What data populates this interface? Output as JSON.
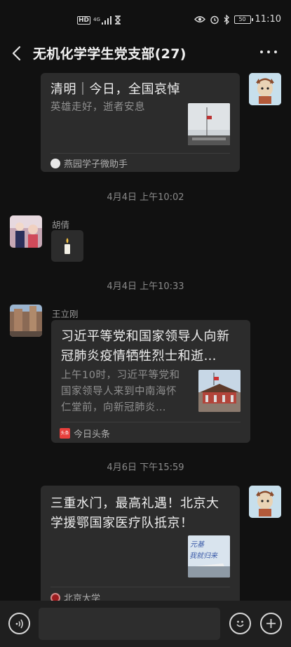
{
  "status_bar": {
    "hd": "HD",
    "network": "4G",
    "battery": "50",
    "time": "11:10"
  },
  "header": {
    "title": "无机化学学生党支部(27)"
  },
  "messages": [
    {
      "type": "card",
      "title": "清明｜今日，全国哀悼",
      "desc": "英雄走好，逝者安息",
      "source": "燕园学子微助手"
    },
    {
      "type": "time",
      "text": "4月4日 上午10:02"
    },
    {
      "type": "text",
      "sender": "胡倩",
      "content": "🕯"
    },
    {
      "type": "time",
      "text": "4月4日 上午10:33"
    },
    {
      "type": "card",
      "sender": "王立刚",
      "title_lines": [
        "习近平等党和国家领导人向新",
        "冠肺炎疫情牺牲烈士和逝…"
      ],
      "desc_lines": [
        "上午10时，习近平等党和",
        "国家领导人来到中南海怀",
        "仁堂前，向新冠肺炎…"
      ],
      "source": "今日头条",
      "source_icon_text": "头条"
    },
    {
      "type": "time",
      "text": "4月6日 下午15:59"
    },
    {
      "type": "card",
      "title_lines": [
        "三重水门，最高礼遇！北京大",
        "学援鄂国家医疗队抵京！"
      ],
      "thumb_text": [
        "元基",
        "我就归来"
      ],
      "source": "北京大学"
    }
  ],
  "input": {
    "placeholder": ""
  },
  "colors": {
    "background": "#111111",
    "bubble": "#2c2c2c",
    "toutiao_red": "#e8403c",
    "pku_red": "#9b1b1e"
  }
}
